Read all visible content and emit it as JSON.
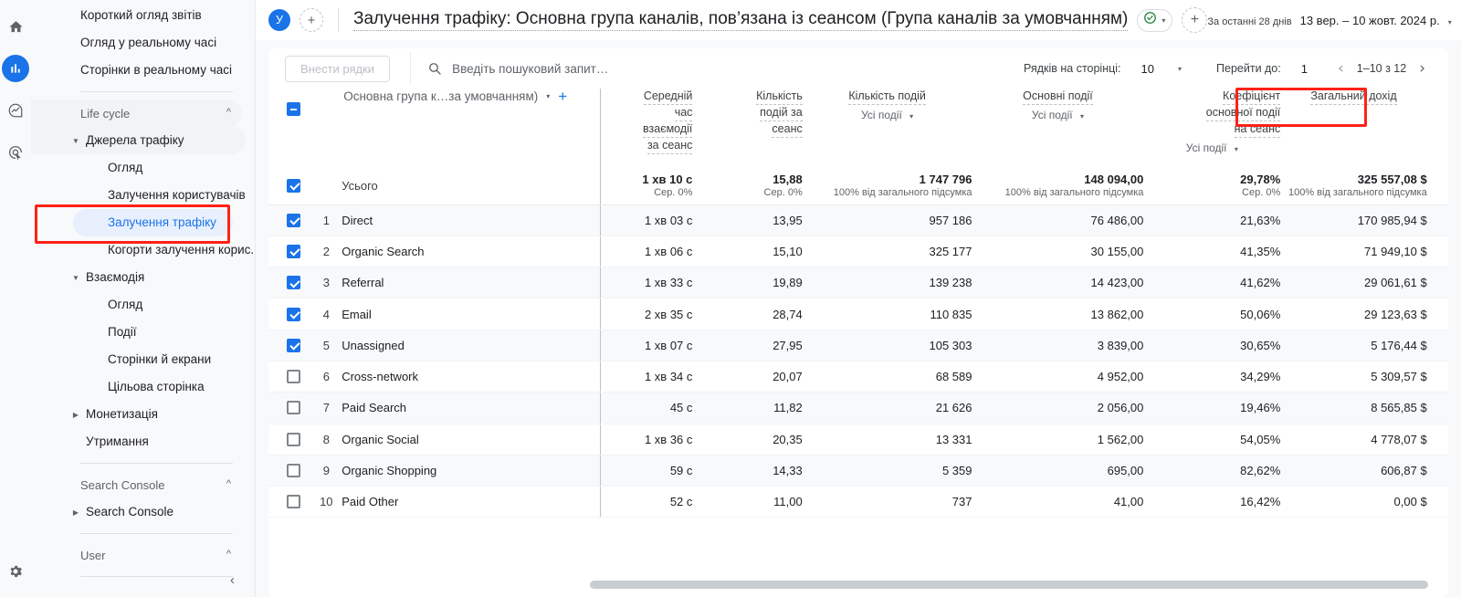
{
  "rail": {
    "icons": [
      {
        "name": "home-icon",
        "label": "Home"
      },
      {
        "name": "reports-bar-chart-icon",
        "label": "Reports"
      },
      {
        "name": "explore-icon",
        "label": "Explore"
      },
      {
        "name": "advertising-icon",
        "label": "Advertising"
      }
    ],
    "settings_label": "Адміністратор"
  },
  "sidebar": {
    "items": [
      {
        "label": "Короткий огляд звітів",
        "level": 1,
        "type": "link"
      },
      {
        "label": "Огляд у реальному часі",
        "level": 1,
        "type": "link"
      },
      {
        "label": "Сторінки в реальному часі",
        "level": 1,
        "type": "link"
      },
      {
        "label": "Life cycle",
        "level": 0,
        "type": "group"
      },
      {
        "label": "Джерела трафіку",
        "level": 0,
        "type": "expandable-open"
      },
      {
        "label": "Огляд",
        "level": 2,
        "type": "link"
      },
      {
        "label": "Залучення користувачів",
        "level": 2,
        "type": "link"
      },
      {
        "label": "Залучення трафіку",
        "level": 2,
        "type": "active"
      },
      {
        "label": "Когорти залучення корис...",
        "level": 2,
        "type": "link"
      },
      {
        "label": "Взаємодія",
        "level": 0,
        "type": "expandable-open"
      },
      {
        "label": "Огляд",
        "level": 2,
        "type": "link"
      },
      {
        "label": "Події",
        "level": 2,
        "type": "link"
      },
      {
        "label": "Сторінки й екрани",
        "level": 2,
        "type": "link"
      },
      {
        "label": "Цільова сторінка",
        "level": 2,
        "type": "link"
      },
      {
        "label": "Монетизація",
        "level": 0,
        "type": "expandable-closed"
      },
      {
        "label": "Утримання",
        "level": 1,
        "type": "link"
      },
      {
        "label": "Search Console",
        "level": 0,
        "type": "group"
      },
      {
        "label": "Search Console",
        "level": 0,
        "type": "expandable-closed"
      },
      {
        "label": "User",
        "level": 0,
        "type": "group"
      }
    ],
    "collapse_icon": "‹"
  },
  "header": {
    "avatar_letter": "У",
    "add_comparison_icon": "+",
    "title": "Залучення трафіку: Основна група каналів, пов’язана із сеансом (Група каналів за умовчанням)",
    "check_chip_icon": "check-circle-icon",
    "check_chip_caret": "▾",
    "add_chip_icon": "+",
    "date_label": "За останні 28 днів",
    "date_value": "13 вер. – 10 жовт. 2024 р.",
    "date_caret": "▾"
  },
  "toolbar": {
    "insert_rows_label": "Внести рядки",
    "search_placeholder": "Введіть пошуковий запит…",
    "rows_per_page_label": "Рядків на сторінці:",
    "rows_per_page_value": "10",
    "rows_caret": "▾",
    "goto_label": "Перейти до:",
    "goto_value": "1",
    "prev_icon": "‹",
    "range_text": "1–10 з 12",
    "next_icon": "›"
  },
  "table": {
    "dimension_header": "Основна група к…за умовчанням)",
    "dimension_caret": "▾",
    "dimension_add": "+",
    "columns": [
      {
        "title": "Середній час взаємодії за сеанс",
        "lines": [
          "Середній",
          "час",
          "взаємодії",
          "за сеанс"
        ],
        "sub": "",
        "sub_caret": ""
      },
      {
        "title": "Кількість подій за сеанс",
        "lines": [
          "Кількість",
          "подій за",
          "сеанс"
        ],
        "sub": "",
        "sub_caret": ""
      },
      {
        "title": "Кількість подій",
        "lines": [
          "Кількість подій"
        ],
        "sub": "Усі події",
        "sub_caret": "▾"
      },
      {
        "title": "Основні події",
        "lines": [
          "Основні події"
        ],
        "sub": "Усі події",
        "sub_caret": "▾"
      },
      {
        "title": "Коефіцієнт основної події на сеанс",
        "lines": [
          "Коефіцієнт",
          "основної події",
          "на сеанс"
        ],
        "sub": "Усі події",
        "sub_caret": "▾"
      },
      {
        "title": "Загальний дохід",
        "lines": [
          "Загальний дохід"
        ],
        "sub": "",
        "sub_caret": ""
      }
    ],
    "total_row": {
      "checked": true,
      "label": "Усього",
      "values": [
        "1 хв 10 с",
        "15,88",
        "1 747 796",
        "148 094,00",
        "29,78%",
        "325 557,08 $"
      ],
      "subs": [
        "Сер. 0%",
        "Сер. 0%",
        "100% від загального підсумка",
        "100% від загального підсумка",
        "Сер. 0%",
        "100% від загального підсумка"
      ]
    },
    "rows": [
      {
        "index": "1",
        "checked": true,
        "name": "Direct",
        "values": [
          "1 хв 03 с",
          "13,95",
          "957 186",
          "76 486,00",
          "21,63%",
          "170 985,94 $"
        ]
      },
      {
        "index": "2",
        "checked": true,
        "name": "Organic Search",
        "values": [
          "1 хв 06 с",
          "15,10",
          "325 177",
          "30 155,00",
          "41,35%",
          "71 949,10 $"
        ]
      },
      {
        "index": "3",
        "checked": true,
        "name": "Referral",
        "values": [
          "1 хв 33 с",
          "19,89",
          "139 238",
          "14 423,00",
          "41,62%",
          "29 061,61 $"
        ]
      },
      {
        "index": "4",
        "checked": true,
        "name": "Email",
        "values": [
          "2 хв 35 с",
          "28,74",
          "110 835",
          "13 862,00",
          "50,06%",
          "29 123,63 $"
        ]
      },
      {
        "index": "5",
        "checked": true,
        "name": "Unassigned",
        "values": [
          "1 хв 07 с",
          "27,95",
          "105 303",
          "3 839,00",
          "30,65%",
          "5 176,44 $"
        ]
      },
      {
        "index": "6",
        "checked": false,
        "name": "Cross-network",
        "values": [
          "1 хв 34 с",
          "20,07",
          "68 589",
          "4 952,00",
          "34,29%",
          "5 309,57 $"
        ]
      },
      {
        "index": "7",
        "checked": false,
        "name": "Paid Search",
        "values": [
          "45 с",
          "11,82",
          "21 626",
          "2 056,00",
          "19,46%",
          "8 565,85 $"
        ]
      },
      {
        "index": "8",
        "checked": false,
        "name": "Organic Social",
        "values": [
          "1 хв 36 с",
          "20,35",
          "13 331",
          "1 562,00",
          "54,05%",
          "4 778,07 $"
        ]
      },
      {
        "index": "9",
        "checked": false,
        "name": "Organic Shopping",
        "values": [
          "59 с",
          "14,33",
          "5 359",
          "695,00",
          "82,62%",
          "606,87 $"
        ]
      },
      {
        "index": "10",
        "checked": false,
        "name": "Paid Other",
        "values": [
          "52 с",
          "11,00",
          "737",
          "41,00",
          "16,42%",
          "0,00 $"
        ]
      }
    ]
  },
  "annotations": {
    "highlight_color": "#ff2116",
    "boxes": [
      "sidebar-traffic-acquisition",
      "column-total-revenue"
    ]
  }
}
